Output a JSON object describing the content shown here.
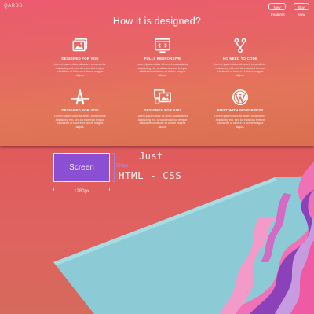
{
  "brand": "QARDS",
  "nav": {
    "primary_label": "New Features",
    "secondary_label": "Buy Now"
  },
  "hero": {
    "title": "How it is designed?"
  },
  "features": [
    {
      "icon": "images-icon",
      "title": "DESIGNED FOR YOU",
      "description": "Lorem ipsum dolor sit amet, consectetur adipiscing elit, sed do eiusmod tempor incididunt ut labore et dolore magna aliqua."
    },
    {
      "icon": "code-window-icon",
      "title": "FULLY RESPONSIVE",
      "description": "Lorem ipsum dolor sit amet, consectetur adipiscing elit, sed do eiusmod tempor incididunt ut labore et dolore magna aliqua."
    },
    {
      "icon": "branch-icon",
      "title": "NO NEED TO CODE",
      "description": "Lorem ipsum dolor sit amet, consectetur adipiscing elit, sed do eiusmod tempor incididunt ut labore et dolore magna aliqua."
    },
    {
      "icon": "letter-a-logo-icon",
      "title": "DESIGNED FOR YOU",
      "description": "Lorem ipsum dolor sit amet, consectetur adipiscing elit, sed do eiusmod tempor incididunt ut labore et dolore magna aliqua."
    },
    {
      "icon": "photos-icon",
      "title": "DESIGNED FOR YOU",
      "description": "Lorem ipsum dolor sit amet, consectetur adipiscing elit, sed do eiusmod tempor incididunt ut labore et dolore magna aliqua."
    },
    {
      "icon": "wordpress-icon",
      "title": "BUILT WITH WORDPRESS",
      "description": "Lorem ipsum dolor sit amet, consectetur adipiscing elit, sed do eiusmod tempor incididunt ut labore et dolore magna aliqua."
    }
  ],
  "illustration": {
    "screen_label": "Screen",
    "width_label": "1280px",
    "height_label": "720px",
    "tagline_line1": "Just",
    "tagline_line2": "HTML - CSS"
  },
  "colors": {
    "hero_top": "#ec5a70",
    "hero_bottom": "#d9704f",
    "screen_fill": "#8a4fd2",
    "floor_blue": "#8ccbd6",
    "wave_pink": "#f072b6",
    "wave_purple": "#8b42b8",
    "wave_lilac": "#c69be0"
  }
}
